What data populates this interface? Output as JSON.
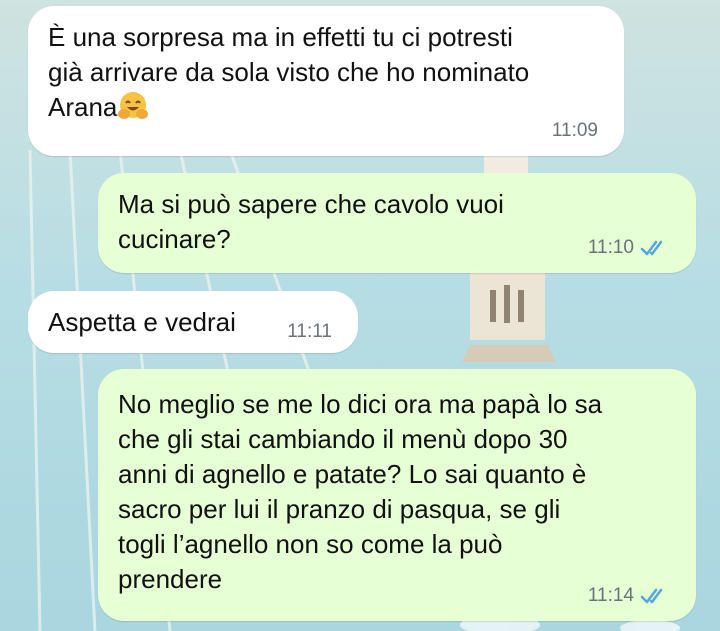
{
  "messages": [
    {
      "direction": "incoming",
      "text": "È una sorpresa ma in effetti tu ci potresti\ngià arrivare da sola visto che ho nominato\nArana",
      "emoji": "hugging-face-emoji",
      "time": "11:09"
    },
    {
      "direction": "outgoing",
      "text": "Ma si può sapere che cavolo vuoi\ncucinare?",
      "time": "11:10",
      "status": "read"
    },
    {
      "direction": "incoming",
      "text": "Aspetta e vedrai",
      "time": "11:11"
    },
    {
      "direction": "outgoing",
      "text": "No meglio se me lo dici ora ma papà lo sa\nche gli stai cambiando il menù dopo 30\nanni di agnello e patate? Lo sai quanto è\nsacro per lui il pranzo di pasqua, se gli\ntogli l’agnello non so come la può\nprendere",
      "time": "11:14",
      "status": "read"
    }
  ],
  "colors": {
    "incoming_bubble": "#ffffff",
    "outgoing_bubble": "#e6ffd4",
    "read_ticks": "#4fa8e0",
    "timestamp": "#6a7378",
    "wallpaper": "#b9dde3"
  }
}
